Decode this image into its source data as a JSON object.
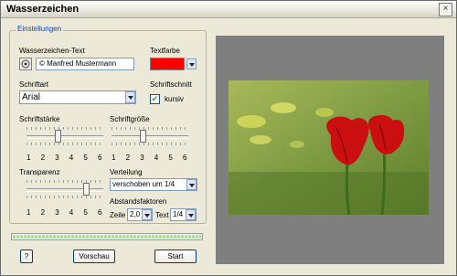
{
  "window": {
    "title": "Wasserzeichen",
    "close_label": "×"
  },
  "settings": {
    "group_label": "Einstellungen",
    "text_label": "Wasserzeichen-Text",
    "text_value": "© Manfred Mustermann",
    "color_label": "Textfarbe",
    "color_value": "#ff0000",
    "font_label": "Schriftart",
    "font_value": "Arial",
    "style_label": "Schriftschnitt",
    "italic_label": "kursiv",
    "italic_checked": true,
    "check_mark": "✔",
    "weight_label": "Schriftstärke",
    "weight_value": 3,
    "size_label": "Schriftgröße",
    "size_value": 3,
    "transparency_label": "Transparenz",
    "transparency_value": 5,
    "scale": [
      "1",
      "2",
      "3",
      "4",
      "5",
      "6"
    ],
    "distribution_label": "Verteilung",
    "distribution_value": "verschoben um 1/4",
    "spacing_label": "Abstandsfaktoren",
    "row_label": "Zeile",
    "row_value": "2,0",
    "text_spacing_label": "Text",
    "text_spacing_value": "1/4"
  },
  "progress": {
    "value": 1.0
  },
  "buttons": {
    "help": "?",
    "preview": "Vorschau",
    "start": "Start"
  },
  "icons": {
    "text_settings": "target-icon"
  }
}
